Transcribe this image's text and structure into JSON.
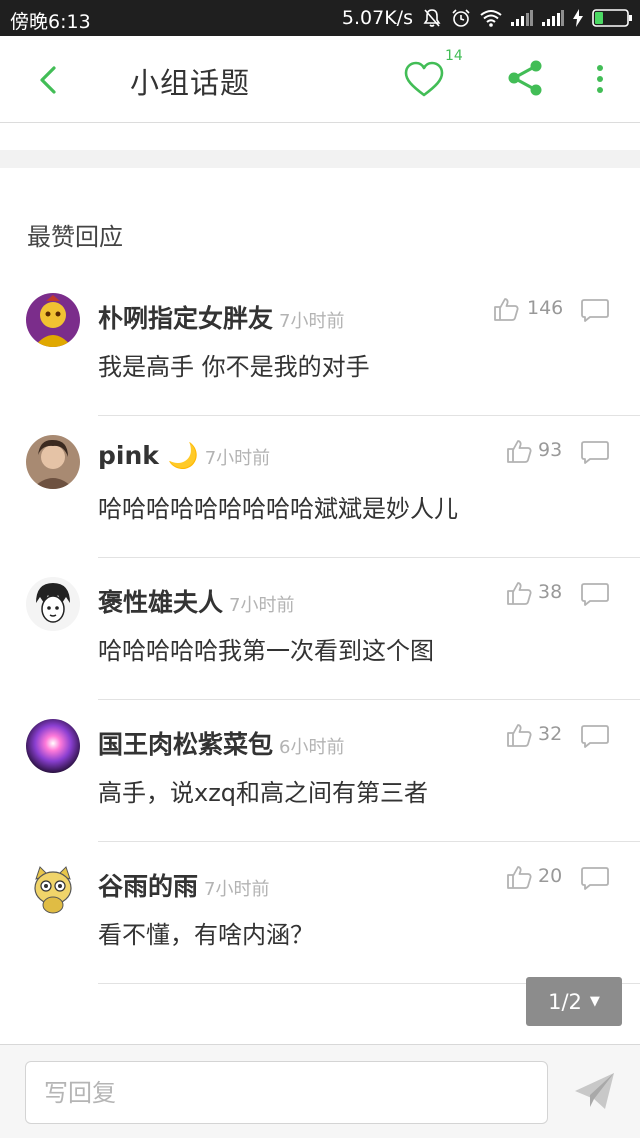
{
  "status_bar": {
    "time": "傍晚6:13",
    "speed": "5.07K/s"
  },
  "header": {
    "title": "小组话题",
    "like_count": "14"
  },
  "section_title": "最赞回应",
  "comments": [
    {
      "name": "朴咧指定女胖友",
      "time": "7小时前",
      "text": "我是高手 你不是我的对手",
      "likes": "146",
      "avatar": "anime-character-avatar"
    },
    {
      "name": "pink 🌙",
      "time": "7小时前",
      "text": "哈哈哈哈哈哈哈哈哈斌斌是妙人儿",
      "likes": "93",
      "avatar": "photo-avatar"
    },
    {
      "name": "褒性雄夫人",
      "time": "7小时前",
      "text": "哈哈哈哈哈我第一次看到这个图",
      "likes": "38",
      "avatar": "sketch-avatar"
    },
    {
      "name": "国王肉松紫菜包",
      "time": "6小时前",
      "text": "高手，说xzq和高之间有第三者",
      "likes": "32",
      "avatar": "purple-glow-avatar"
    },
    {
      "name": "谷雨的雨",
      "time": "7小时前",
      "text": "看不懂，有啥内涵？",
      "likes": "20",
      "avatar": "cat-avatar"
    }
  ],
  "pagination": {
    "label": "1/2",
    "arrow": "▼"
  },
  "reply": {
    "placeholder": "写回复"
  },
  "colors": {
    "accent": "#42bd56",
    "status_bar": "#1f1f1f"
  }
}
